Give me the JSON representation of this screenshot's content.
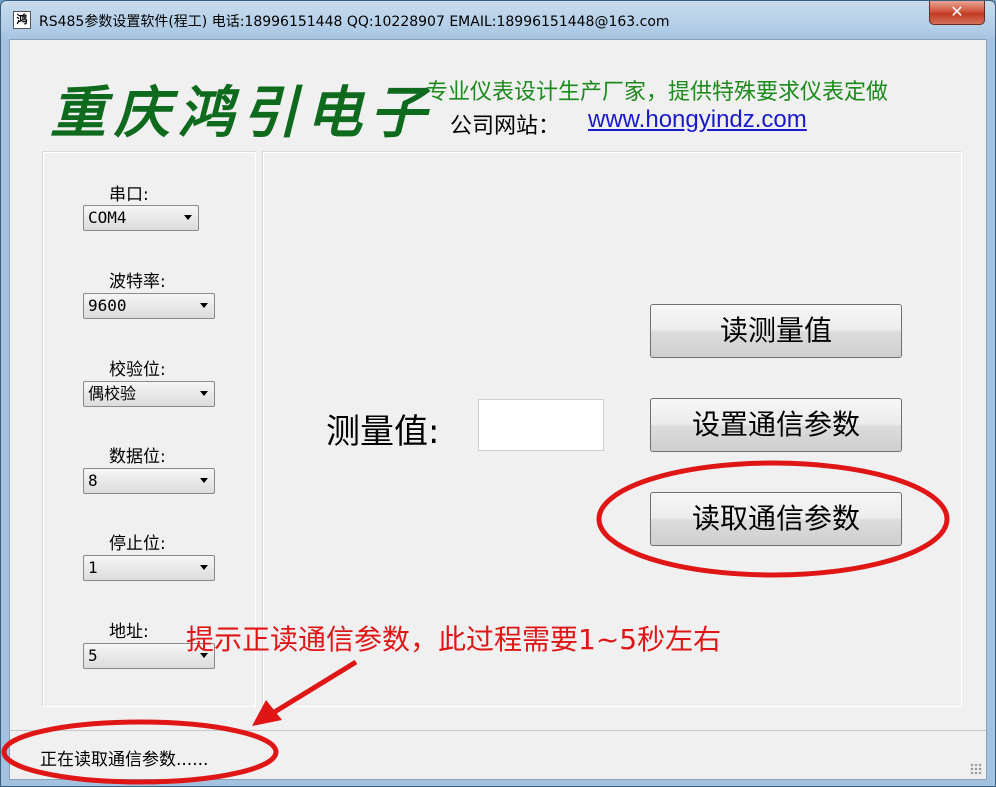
{
  "window": {
    "icon_glyph": "鸿",
    "title": "RS485参数设置软件(程工)  电话:18996151448  QQ:10228907  EMAIL:18996151448@163.com",
    "close_label": "✕"
  },
  "header": {
    "logo_text": "重庆鸿引电子",
    "slogan": "专业仪表设计生产厂家，提供特殊要求仪表定做",
    "site_label": "公司网站：",
    "site_url": "www.hongyindz.com"
  },
  "settings": {
    "port": {
      "label": "串口:",
      "value": "COM4"
    },
    "baud": {
      "label": "波特率:",
      "value": "9600"
    },
    "parity": {
      "label": "校验位:",
      "value": "偶校验"
    },
    "data_bits": {
      "label": "数据位:",
      "value": "8"
    },
    "stop_bits": {
      "label": "停止位:",
      "value": "1"
    },
    "address": {
      "label": "地址:",
      "value": "5"
    }
  },
  "main": {
    "measure_label": "测量值:",
    "measure_value": "",
    "read_measure_button": "读测量值",
    "set_params_button": "设置通信参数",
    "read_params_button": "读取通信参数"
  },
  "annotation": {
    "text": "提示正读通信参数，此过程需要1~5秒左右",
    "color": "#e01616"
  },
  "status": {
    "text": "正在读取通信参数......"
  },
  "colors": {
    "logo": "#0e6a1c",
    "slogan": "#1c8a1c",
    "link": "#1a1acc",
    "annotation": "#e01616"
  }
}
